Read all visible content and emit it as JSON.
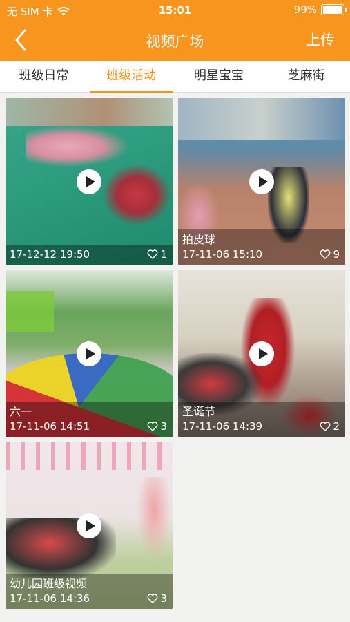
{
  "status_bar": {
    "carrier": "无 SIM 卡",
    "time": "15:01",
    "battery_text": "99%",
    "battery_level": 0.99,
    "wifi_icon": "wifi-icon"
  },
  "nav": {
    "back_icon": "chevron-left-icon",
    "title": "视频广场",
    "upload_label": "上传"
  },
  "tabs": [
    {
      "label": "班级日常",
      "active": false
    },
    {
      "label": "班级活动",
      "active": true
    },
    {
      "label": "明星宝宝",
      "active": false
    },
    {
      "label": "芝麻街",
      "active": false
    }
  ],
  "videos": [
    {
      "caption": "",
      "date": "17-12-12 19:50",
      "likes": "1"
    },
    {
      "caption": "拍皮球",
      "date": "17-11-06 15:10",
      "likes": "9"
    },
    {
      "caption": "六一",
      "date": "17-11-06 14:51",
      "likes": "3"
    },
    {
      "caption": "圣诞节",
      "date": "17-11-06 14:39",
      "likes": "2"
    },
    {
      "caption": "幼儿园班级视频",
      "date": "17-11-06 14:36",
      "likes": "3"
    }
  ],
  "colors": {
    "accent": "#f7951e",
    "page_background": "#f2f2f0"
  }
}
